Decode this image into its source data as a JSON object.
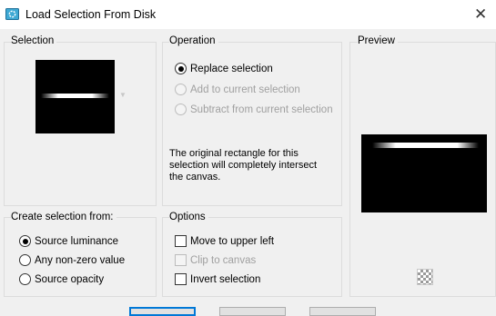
{
  "window": {
    "title": "Load Selection From Disk",
    "close_glyph": "✕",
    "icon": "selection-disk-icon"
  },
  "selection": {
    "heading": "Selection",
    "dropdown_glyph": "▼"
  },
  "operation": {
    "heading": "Operation",
    "options": [
      {
        "label": "Replace selection",
        "checked": true,
        "enabled": true
      },
      {
        "label": "Add to current selection",
        "checked": false,
        "enabled": false
      },
      {
        "label": "Subtract from current selection",
        "checked": false,
        "enabled": false
      }
    ],
    "description": "The original rectangle for this selection will completely intersect the canvas."
  },
  "preview": {
    "heading": "Preview"
  },
  "create_from": {
    "heading": "Create selection from:",
    "options": [
      {
        "label": "Source luminance",
        "checked": true
      },
      {
        "label": "Any non-zero value",
        "checked": false
      },
      {
        "label": "Source opacity",
        "checked": false
      }
    ]
  },
  "options": {
    "heading": "Options",
    "items": [
      {
        "label": "Move to upper left",
        "checked": false,
        "enabled": true
      },
      {
        "label": "Clip to canvas",
        "checked": false,
        "enabled": false
      },
      {
        "label": "Invert selection",
        "checked": false,
        "enabled": true
      }
    ]
  },
  "colors": {
    "accent": "#0078d7",
    "background": "#f0f0f0",
    "disabled_text": "#a0a0a0"
  }
}
